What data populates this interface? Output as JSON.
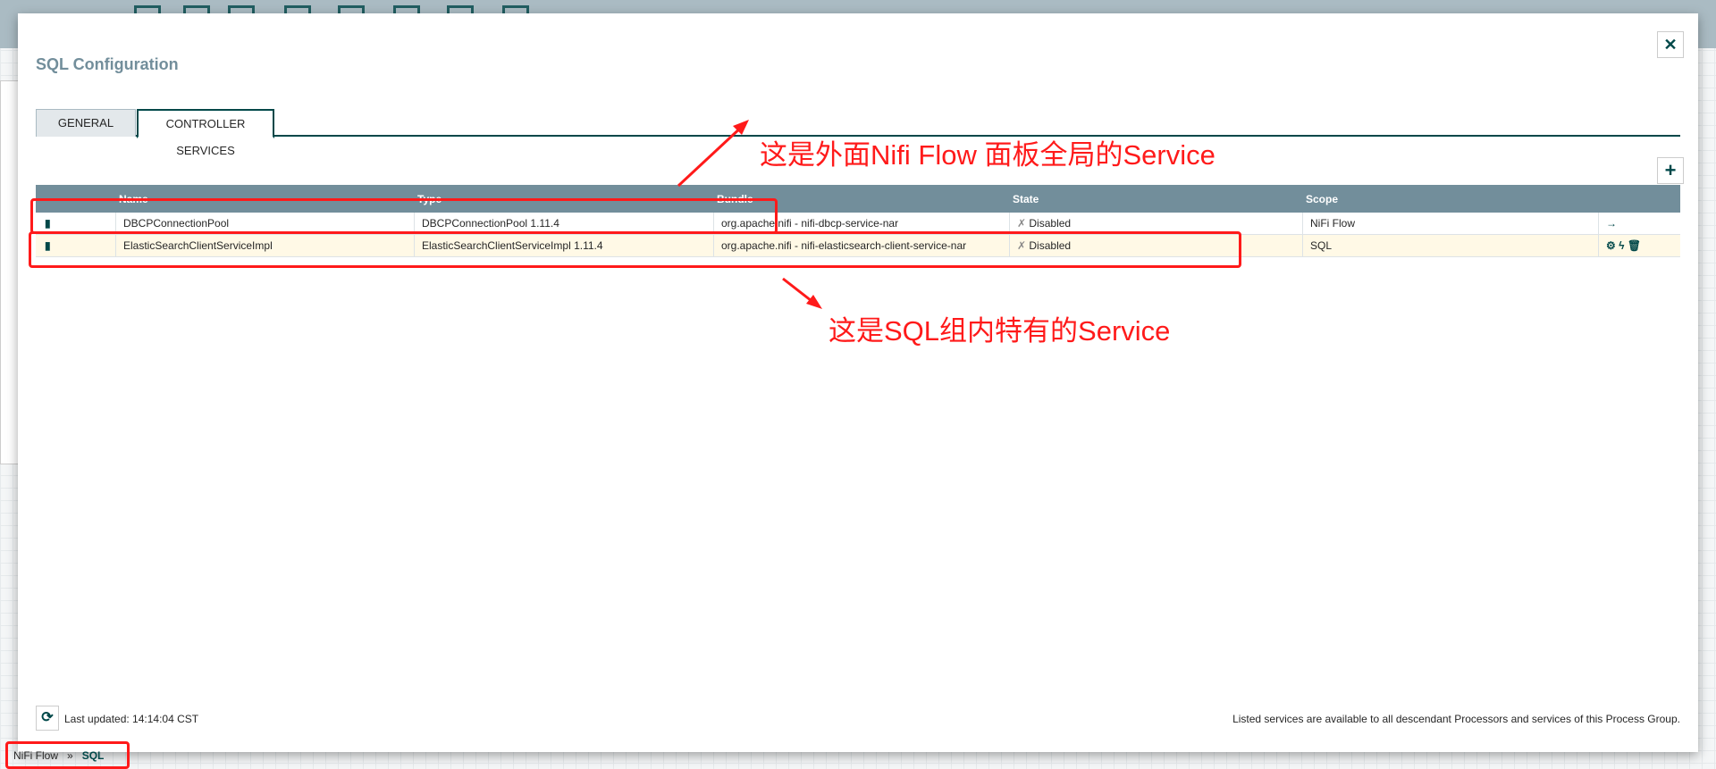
{
  "dialog": {
    "title": "SQL Configuration",
    "close_icon": "close-icon"
  },
  "tabs": [
    {
      "label": "GENERAL"
    },
    {
      "label": "CONTROLLER SERVICES",
      "active": true
    }
  ],
  "table": {
    "headers": {
      "name": "Name",
      "type": "Type",
      "bundle": "Bundle",
      "state": "State",
      "scope": "Scope"
    },
    "rows": [
      {
        "name": "DBCPConnectionPool",
        "type": "DBCPConnectionPool 1.11.4",
        "bundle": "org.apache.nifi - nifi-dbcp-service-nar",
        "state": "Disabled",
        "scope": "NiFi Flow",
        "actions": [
          "go-to-arrow-icon"
        ]
      },
      {
        "name": "ElasticSearchClientServiceImpl",
        "type": "ElasticSearchClientServiceImpl 1.11.4",
        "bundle": "org.apache.nifi - nifi-elasticsearch-client-service-nar",
        "state": "Disabled",
        "scope": "SQL",
        "actions": [
          "gear-icon",
          "lightning-icon",
          "trash-icon"
        ]
      }
    ]
  },
  "footer": {
    "last_updated": "Last updated: 14:14:04 CST",
    "note": "Listed services are available to all descendant Processors and services of this Process Group."
  },
  "breadcrumb": {
    "root": "NiFi Flow",
    "sep": "»",
    "current": "SQL"
  },
  "annotations": {
    "top": "这是外面Nifi Flow 面板全局的Service",
    "bottom": "这是SQL组内特有的Service",
    "color": "#ff1a1a"
  },
  "colors": {
    "accent": "#004849",
    "header": "#728e9b",
    "row_alt": "#fff9e6"
  }
}
